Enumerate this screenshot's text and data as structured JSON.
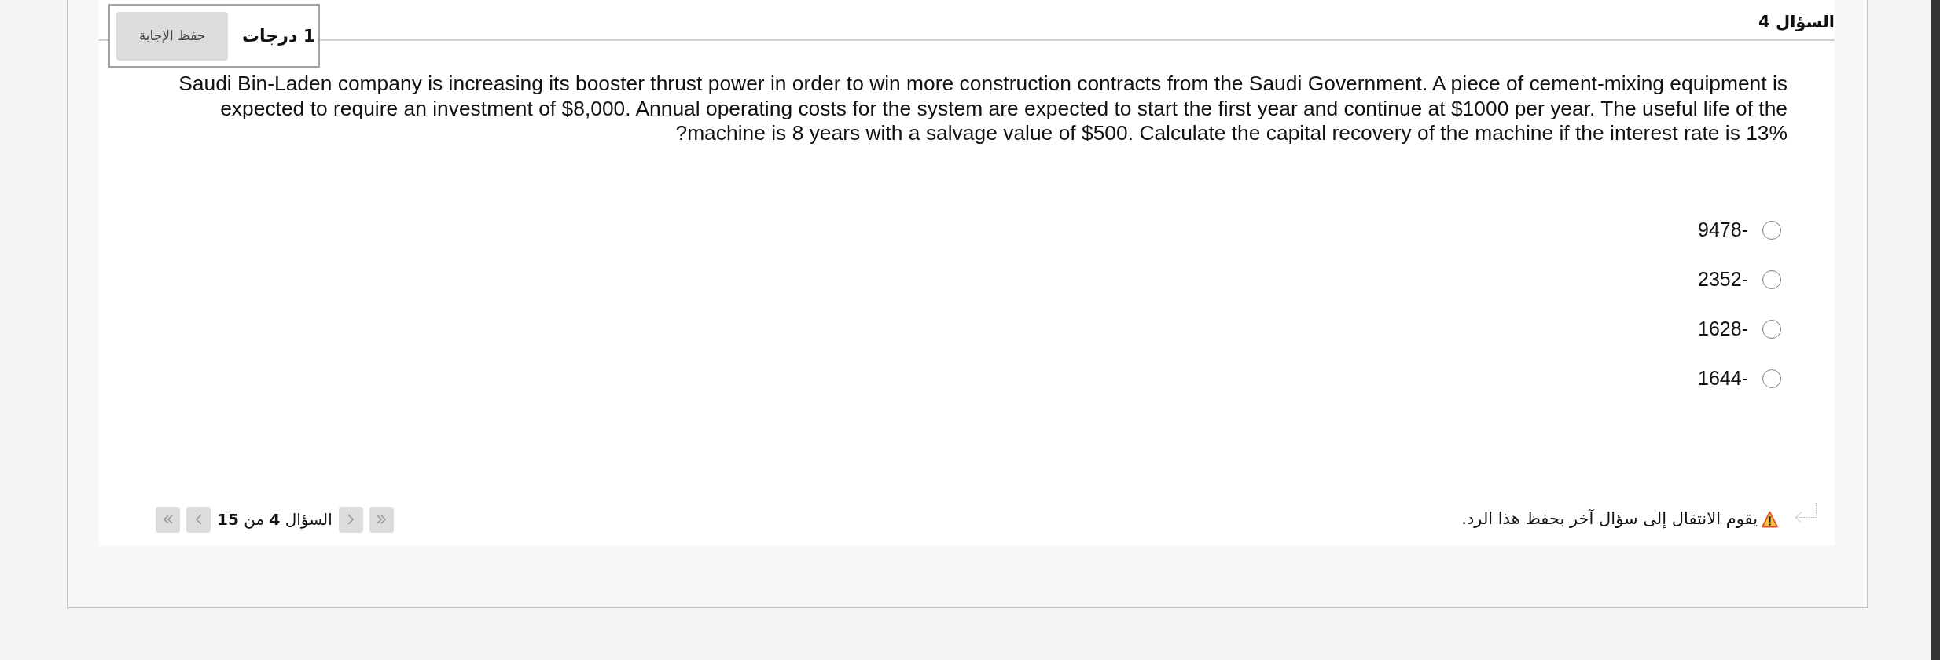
{
  "question": {
    "title": "السؤال 4",
    "points": "1 درجات",
    "save_button": "حفظ الإجابة",
    "text": "Saudi Bin-Laden company is increasing its booster thrust power in order to win more construction contracts from the Saudi Government. A piece of cement-mixing equipment is expected to require an investment of $8,000. Annual operating costs for the system are expected to start the first year and continue at $1000 per year. The useful life of the ?machine is 8 years with a salvage value of $500. Calculate the capital recovery of the machine if the interest rate is 13%"
  },
  "options": [
    {
      "label": "9478-",
      "selected": false
    },
    {
      "label": "2352-",
      "selected": false
    },
    {
      "label": "1628-",
      "selected": false
    },
    {
      "label": "1644-",
      "selected": false
    }
  ],
  "footer": {
    "position": "السؤال **4** من **15**",
    "notice": "يقوم الانتقال إلى سؤال آخر بحفظ هذا الرد."
  }
}
